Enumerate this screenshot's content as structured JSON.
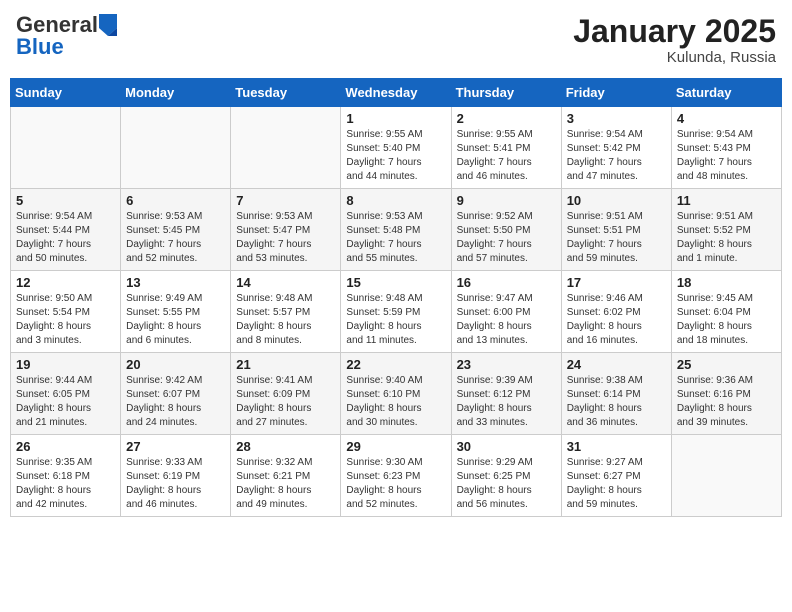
{
  "header": {
    "logo_general": "General",
    "logo_blue": "Blue",
    "month_title": "January 2025",
    "location": "Kulunda, Russia"
  },
  "weekdays": [
    "Sunday",
    "Monday",
    "Tuesday",
    "Wednesday",
    "Thursday",
    "Friday",
    "Saturday"
  ],
  "weeks": [
    [
      {
        "day": "",
        "info": ""
      },
      {
        "day": "",
        "info": ""
      },
      {
        "day": "",
        "info": ""
      },
      {
        "day": "1",
        "info": "Sunrise: 9:55 AM\nSunset: 5:40 PM\nDaylight: 7 hours\nand 44 minutes."
      },
      {
        "day": "2",
        "info": "Sunrise: 9:55 AM\nSunset: 5:41 PM\nDaylight: 7 hours\nand 46 minutes."
      },
      {
        "day": "3",
        "info": "Sunrise: 9:54 AM\nSunset: 5:42 PM\nDaylight: 7 hours\nand 47 minutes."
      },
      {
        "day": "4",
        "info": "Sunrise: 9:54 AM\nSunset: 5:43 PM\nDaylight: 7 hours\nand 48 minutes."
      }
    ],
    [
      {
        "day": "5",
        "info": "Sunrise: 9:54 AM\nSunset: 5:44 PM\nDaylight: 7 hours\nand 50 minutes."
      },
      {
        "day": "6",
        "info": "Sunrise: 9:53 AM\nSunset: 5:45 PM\nDaylight: 7 hours\nand 52 minutes."
      },
      {
        "day": "7",
        "info": "Sunrise: 9:53 AM\nSunset: 5:47 PM\nDaylight: 7 hours\nand 53 minutes."
      },
      {
        "day": "8",
        "info": "Sunrise: 9:53 AM\nSunset: 5:48 PM\nDaylight: 7 hours\nand 55 minutes."
      },
      {
        "day": "9",
        "info": "Sunrise: 9:52 AM\nSunset: 5:50 PM\nDaylight: 7 hours\nand 57 minutes."
      },
      {
        "day": "10",
        "info": "Sunrise: 9:51 AM\nSunset: 5:51 PM\nDaylight: 7 hours\nand 59 minutes."
      },
      {
        "day": "11",
        "info": "Sunrise: 9:51 AM\nSunset: 5:52 PM\nDaylight: 8 hours\nand 1 minute."
      }
    ],
    [
      {
        "day": "12",
        "info": "Sunrise: 9:50 AM\nSunset: 5:54 PM\nDaylight: 8 hours\nand 3 minutes."
      },
      {
        "day": "13",
        "info": "Sunrise: 9:49 AM\nSunset: 5:55 PM\nDaylight: 8 hours\nand 6 minutes."
      },
      {
        "day": "14",
        "info": "Sunrise: 9:48 AM\nSunset: 5:57 PM\nDaylight: 8 hours\nand 8 minutes."
      },
      {
        "day": "15",
        "info": "Sunrise: 9:48 AM\nSunset: 5:59 PM\nDaylight: 8 hours\nand 11 minutes."
      },
      {
        "day": "16",
        "info": "Sunrise: 9:47 AM\nSunset: 6:00 PM\nDaylight: 8 hours\nand 13 minutes."
      },
      {
        "day": "17",
        "info": "Sunrise: 9:46 AM\nSunset: 6:02 PM\nDaylight: 8 hours\nand 16 minutes."
      },
      {
        "day": "18",
        "info": "Sunrise: 9:45 AM\nSunset: 6:04 PM\nDaylight: 8 hours\nand 18 minutes."
      }
    ],
    [
      {
        "day": "19",
        "info": "Sunrise: 9:44 AM\nSunset: 6:05 PM\nDaylight: 8 hours\nand 21 minutes."
      },
      {
        "day": "20",
        "info": "Sunrise: 9:42 AM\nSunset: 6:07 PM\nDaylight: 8 hours\nand 24 minutes."
      },
      {
        "day": "21",
        "info": "Sunrise: 9:41 AM\nSunset: 6:09 PM\nDaylight: 8 hours\nand 27 minutes."
      },
      {
        "day": "22",
        "info": "Sunrise: 9:40 AM\nSunset: 6:10 PM\nDaylight: 8 hours\nand 30 minutes."
      },
      {
        "day": "23",
        "info": "Sunrise: 9:39 AM\nSunset: 6:12 PM\nDaylight: 8 hours\nand 33 minutes."
      },
      {
        "day": "24",
        "info": "Sunrise: 9:38 AM\nSunset: 6:14 PM\nDaylight: 8 hours\nand 36 minutes."
      },
      {
        "day": "25",
        "info": "Sunrise: 9:36 AM\nSunset: 6:16 PM\nDaylight: 8 hours\nand 39 minutes."
      }
    ],
    [
      {
        "day": "26",
        "info": "Sunrise: 9:35 AM\nSunset: 6:18 PM\nDaylight: 8 hours\nand 42 minutes."
      },
      {
        "day": "27",
        "info": "Sunrise: 9:33 AM\nSunset: 6:19 PM\nDaylight: 8 hours\nand 46 minutes."
      },
      {
        "day": "28",
        "info": "Sunrise: 9:32 AM\nSunset: 6:21 PM\nDaylight: 8 hours\nand 49 minutes."
      },
      {
        "day": "29",
        "info": "Sunrise: 9:30 AM\nSunset: 6:23 PM\nDaylight: 8 hours\nand 52 minutes."
      },
      {
        "day": "30",
        "info": "Sunrise: 9:29 AM\nSunset: 6:25 PM\nDaylight: 8 hours\nand 56 minutes."
      },
      {
        "day": "31",
        "info": "Sunrise: 9:27 AM\nSunset: 6:27 PM\nDaylight: 8 hours\nand 59 minutes."
      },
      {
        "day": "",
        "info": ""
      }
    ]
  ]
}
